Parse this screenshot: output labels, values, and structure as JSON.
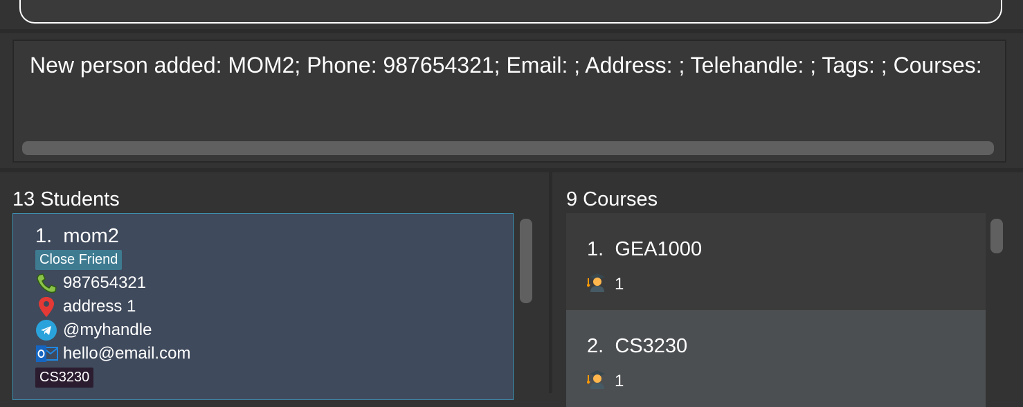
{
  "result": {
    "message": "New person added: MOM2; Phone: 987654321; Email: ; Address: ; Telehandle: ; Tags: ; Courses:"
  },
  "students": {
    "title": "13 Students",
    "items": [
      {
        "index": "1.",
        "name": "mom2",
        "tag": "Close Friend",
        "phone": "987654321",
        "address": "address 1",
        "telehandle": "@myhandle",
        "email": "hello@email.com",
        "course": "CS3230"
      }
    ]
  },
  "courses": {
    "title": "9 Courses",
    "items": [
      {
        "index": "1.",
        "code": "GEA1000",
        "students": "1"
      },
      {
        "index": "2.",
        "code": "CS3230",
        "students": "1"
      }
    ]
  },
  "icons": {
    "phone": "phone-icon",
    "address": "map-pin-icon",
    "telehandle": "telegram-icon",
    "email": "outlook-mail-icon",
    "student": "student-icon"
  },
  "colors": {
    "background": "#333333",
    "selected_card": "#3f4a5c",
    "selected_border": "#3d8fb0",
    "friend_tag": "#3e7b91",
    "course_tag": "#2b1d2f"
  }
}
